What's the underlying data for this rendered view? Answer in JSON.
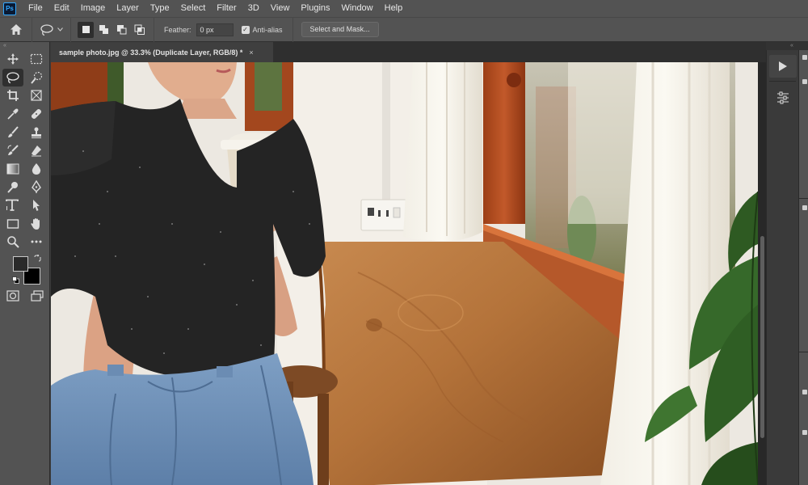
{
  "app": {
    "logo_text": "Ps"
  },
  "menu": [
    "File",
    "Edit",
    "Image",
    "Layer",
    "Type",
    "Select",
    "Filter",
    "3D",
    "View",
    "Plugins",
    "Window",
    "Help"
  ],
  "options": {
    "feather_label": "Feather:",
    "feather_value": "0 px",
    "anti_alias_label": "Anti-alias",
    "anti_alias_checked": true,
    "select_mask_label": "Select and Mask..."
  },
  "document": {
    "tab_title": "sample photo.jpg @ 33.3% (Duplicate Layer, RGB/8) *",
    "close_glyph": "×"
  },
  "toolbar": {
    "collapse_glyph": "«",
    "tools": [
      {
        "name": "move-tool",
        "icon": "move-icon"
      },
      {
        "name": "marquee-tool",
        "icon": "rect-marquee-icon"
      },
      {
        "name": "lasso-tool",
        "icon": "lasso-icon",
        "active": true
      },
      {
        "name": "quick-select-tool",
        "icon": "quick-select-icon"
      },
      {
        "name": "crop-tool",
        "icon": "crop-icon"
      },
      {
        "name": "frame-tool",
        "icon": "frame-icon"
      },
      {
        "name": "eyedropper-tool",
        "icon": "eyedropper-icon"
      },
      {
        "name": "healing-tool",
        "icon": "bandage-icon"
      },
      {
        "name": "brush-tool",
        "icon": "brush-icon"
      },
      {
        "name": "stamp-tool",
        "icon": "stamp-icon"
      },
      {
        "name": "history-brush-tool",
        "icon": "history-brush-icon"
      },
      {
        "name": "eraser-tool",
        "icon": "eraser-icon"
      },
      {
        "name": "gradient-tool",
        "icon": "gradient-icon"
      },
      {
        "name": "blur-tool",
        "icon": "drop-icon"
      },
      {
        "name": "dodge-tool",
        "icon": "dodge-icon"
      },
      {
        "name": "pen-tool",
        "icon": "pen-icon"
      },
      {
        "name": "type-tool",
        "icon": "type-icon"
      },
      {
        "name": "path-select-tool",
        "icon": "arrow-icon"
      },
      {
        "name": "shape-tool",
        "icon": "rectangle-icon"
      },
      {
        "name": "hand-tool",
        "icon": "hand-icon"
      },
      {
        "name": "zoom-tool",
        "icon": "magnifier-icon"
      },
      {
        "name": "more-tools",
        "icon": "ellipsis-icon"
      }
    ],
    "foreground_color": "#2a2a2a",
    "background_color": "#000000"
  },
  "right_panel": {
    "collapse_glyph": "«"
  },
  "colors": {
    "menubar": "#535353",
    "canvas_bg": "#282828",
    "accent": "#31a8ff"
  }
}
